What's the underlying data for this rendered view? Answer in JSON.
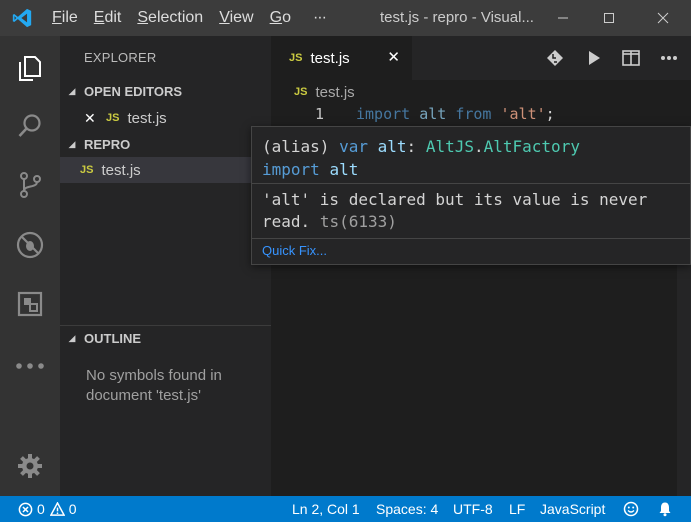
{
  "titlebar": {
    "menu": [
      {
        "pre": "",
        "key": "F",
        "post": "ile"
      },
      {
        "pre": "",
        "key": "E",
        "post": "dit"
      },
      {
        "pre": "",
        "key": "S",
        "post": "election"
      },
      {
        "pre": "",
        "key": "V",
        "post": "iew"
      },
      {
        "pre": "",
        "key": "G",
        "post": "o"
      }
    ],
    "more": "···",
    "title": "test.js - repro - Visual..."
  },
  "sidebar": {
    "title": "EXPLORER",
    "open_editors": {
      "header": "OPEN EDITORS",
      "file_badge": "JS",
      "file_name": "test.js",
      "close_glyph": "✕"
    },
    "repro": {
      "header": "REPRO",
      "file_badge": "JS",
      "file_name": "test.js"
    },
    "outline": {
      "header": "OUTLINE",
      "empty_message": "No symbols found in document 'test.js'"
    }
  },
  "editor": {
    "tab": {
      "badge": "JS",
      "name": "test.js",
      "close_glyph": "✕"
    },
    "breadcrumb": {
      "badge": "JS",
      "name": "test.js"
    },
    "line_number": "1",
    "code": {
      "kw1": "import",
      "id1": "alt",
      "kw2": "from",
      "str": "'alt'",
      "semi": ";"
    }
  },
  "hover": {
    "sig_paren": "(alias)",
    "sig_kw_var": "var",
    "sig_name": "alt",
    "sig_colon": ":",
    "sig_type_ns": "AltJS",
    "sig_dot": ".",
    "sig_type": "AltFactory",
    "sig_line2_kw": "import",
    "sig_line2_name": "alt",
    "message": "'alt' is declared but its value is never read.",
    "code_ref": "ts(6133)",
    "quick_fix": "Quick Fix..."
  },
  "statusbar": {
    "errors": "0",
    "warnings": "0",
    "position": "Ln 2, Col 1",
    "spaces": "Spaces: 4",
    "encoding": "UTF-8",
    "eol": "LF",
    "language": "JavaScript"
  },
  "colors": {
    "accent": "#007acc",
    "js_badge": "#cbcb41",
    "link": "#3794ff"
  }
}
